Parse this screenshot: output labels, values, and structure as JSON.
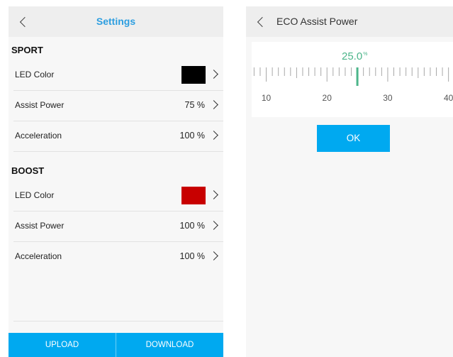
{
  "settings": {
    "title": "Settings",
    "back_icon": "chevron-left-icon",
    "sections": [
      {
        "title": "SPORT",
        "rows": [
          {
            "label": "LED Color",
            "swatch_color": "#000000"
          },
          {
            "label": "Assist Power",
            "value": "75 %"
          },
          {
            "label": "Acceleration",
            "value": "100 %"
          }
        ]
      },
      {
        "title": "BOOST",
        "rows": [
          {
            "label": "LED Color",
            "swatch_color": "#c80000"
          },
          {
            "label": "Assist Power",
            "value": "100 %"
          },
          {
            "label": "Acceleration",
            "value": "100 %"
          }
        ]
      }
    ],
    "upload_label": "UPLOAD",
    "download_label": "DOWNLOAD"
  },
  "eco": {
    "title": "ECO Assist Power",
    "back_icon": "chevron-left-icon",
    "value": "25.0",
    "value_unit": "%",
    "ruler": {
      "min_visible": 7,
      "max_visible": 40,
      "labels": [
        "10",
        "20",
        "30",
        "40"
      ],
      "selected": 25
    },
    "ok_label": "OK"
  },
  "colors": {
    "accent": "#00a9f0",
    "title_blue": "#2d9ee0",
    "ruler_green": "#4cb58a"
  }
}
